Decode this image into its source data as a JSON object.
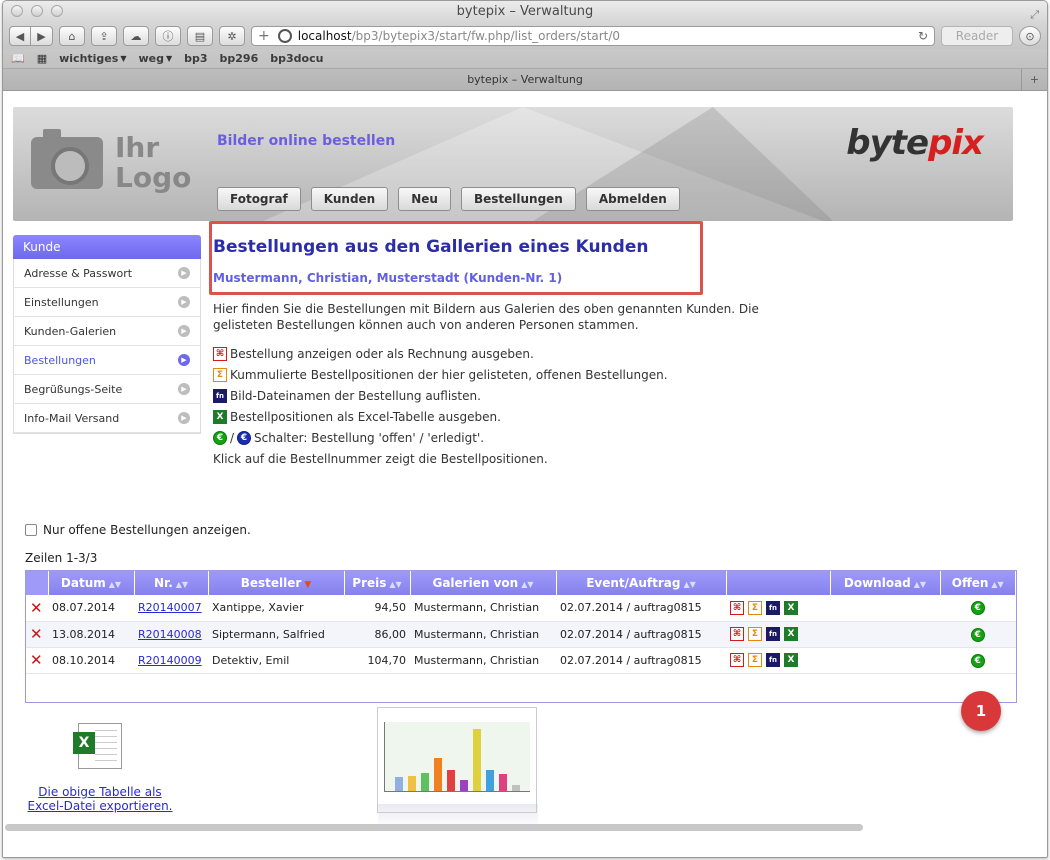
{
  "window": {
    "title": "bytepix – Verwaltung"
  },
  "toolbar": {
    "url_host": "localhost",
    "url_path": "/bp3/bytepix3/start/fw.php/list_orders/start/0",
    "reader": "Reader"
  },
  "bookmarks": [
    "wichtiges",
    "weg",
    "bp3",
    "bp296",
    "bp3docu"
  ],
  "tab": {
    "title": "bytepix – Verwaltung"
  },
  "header": {
    "logo_line1": "Ihr",
    "logo_line2": "Logo",
    "slogan": "Bilder online bestellen",
    "brand_a": "byte",
    "brand_b": "pix",
    "nav": [
      "Fotograf",
      "Kunden",
      "Neu",
      "Bestellungen",
      "Abmelden"
    ]
  },
  "sidebar": {
    "title": "Kunde",
    "items": [
      {
        "label": "Adresse & Passwort",
        "active": false
      },
      {
        "label": "Einstellungen",
        "active": false
      },
      {
        "label": "Kunden-Galerien",
        "active": false
      },
      {
        "label": "Bestellungen",
        "active": true
      },
      {
        "label": "Begrüßungs-Seite",
        "active": false
      },
      {
        "label": "Info-Mail Versand",
        "active": false
      }
    ]
  },
  "main": {
    "title": "Bestellungen aus den Gallerien eines Kunden",
    "subtitle": "Mustermann, Christian, Musterstadt (Kunden-Nr. 1)",
    "desc1": "Hier finden Sie die Bestellungen mit Bildern aus Galerien des oben genannten Kunden. Die",
    "desc2": "gelisteten Bestellungen können auch von anderen Personen stammen.",
    "legend": {
      "pdf": "Bestellung anzeigen oder als Rechnung ausgeben.",
      "sum": "Kummulierte Bestellpositionen der hier gelisteten, offenen Bestellungen.",
      "fn": "Bild-Dateinamen der Bestellung auflisten.",
      "xl": "Bestellpositionen als Excel-Tabelle ausgeben.",
      "slash": "/",
      "toggle": "Schalter: Bestellung 'offen' / 'erledigt'.",
      "click": "Klick auf die Bestellnummer zeigt die Bestellpositionen."
    }
  },
  "filter": {
    "label": "Nur offene Bestellungen anzeigen."
  },
  "rows_info": "Zeilen 1-3/3",
  "table": {
    "headers": [
      "Datum",
      "Nr.",
      "Besteller",
      "Preis",
      "Galerien von",
      "Event/Auftrag",
      "",
      "Download",
      "Offen"
    ],
    "rows": [
      {
        "date": "08.07.2014",
        "nr": "R20140007",
        "besteller": "Xantippe, Xavier",
        "preis": "94,50",
        "galerie": "Mustermann, Christian",
        "event": "02.07.2014 / auftrag0815"
      },
      {
        "date": "13.08.2014",
        "nr": "R20140008",
        "besteller": "Siptermann, Salfried",
        "preis": "86,00",
        "galerie": "Mustermann, Christian",
        "event": "02.07.2014 / auftrag0815"
      },
      {
        "date": "08.10.2014",
        "nr": "R20140009",
        "besteller": "Detektiv, Emil",
        "preis": "104,70",
        "galerie": "Mustermann, Christian",
        "event": "02.07.2014 / auftrag0815"
      }
    ]
  },
  "badge": "1",
  "export": {
    "link1": "Die obige Tabelle als",
    "link2": "Excel-Datei exportieren."
  },
  "icons": {
    "pdf": "pdf-icon",
    "sum": "sigma-icon",
    "fn": "fn-filenames-icon",
    "xl": "excel-icon",
    "eu": "euro-open-icon",
    "eu2": "euro-done-icon",
    "delete": "delete-x-icon"
  },
  "thumb_colors": [
    "#8fb0e0",
    "#f0c040",
    "#60c060",
    "#f08020",
    "#e04040",
    "#a040c0",
    "#e0d040",
    "#40a0e0",
    "#e04080",
    "#c0c0c0"
  ]
}
